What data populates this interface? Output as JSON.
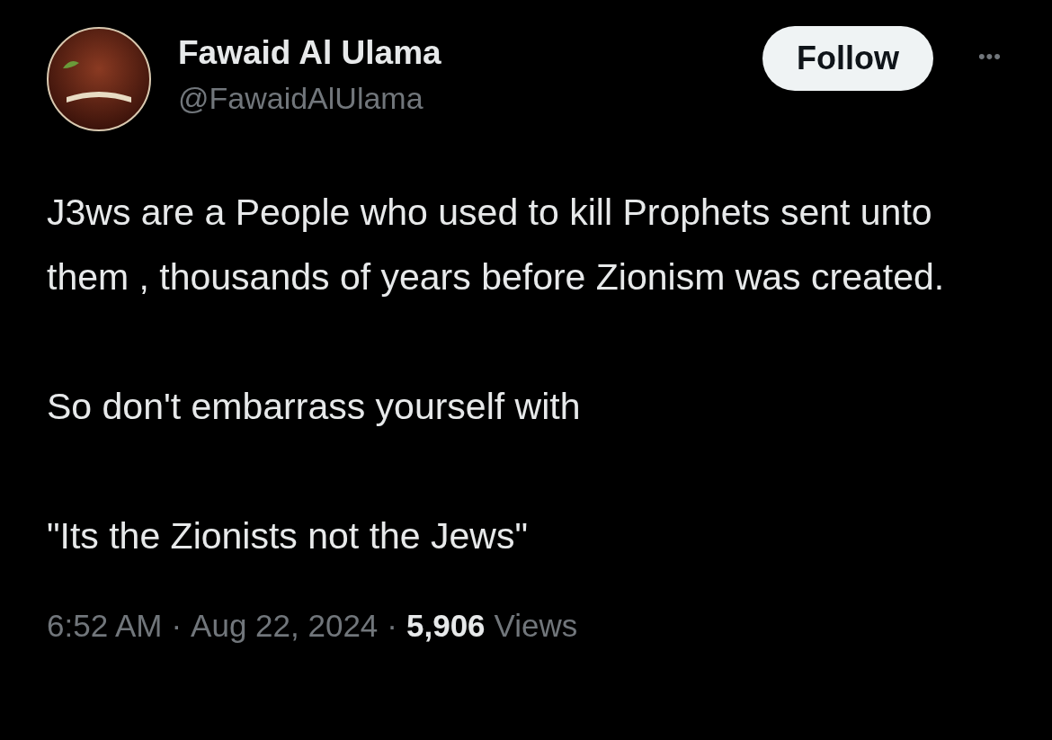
{
  "author": {
    "name": "Fawaid Al Ulama",
    "handle": "@FawaidAlUlama"
  },
  "follow_button": {
    "label": "Follow"
  },
  "more_menu": {
    "label": "•••"
  },
  "tweet": {
    "paragraphs": [
      "J3ws are a People who used to kill Prophets sent unto them , thousands of years before Zionism was created.",
      "So don't embarrass yourself with",
      "\"Its the Zionists not the Jews\""
    ]
  },
  "meta": {
    "time": "6:52 AM",
    "separator_1": "·",
    "date": "Aug 22, 2024",
    "separator_2": "·",
    "views_count": "5,906",
    "views_label": "Views"
  }
}
